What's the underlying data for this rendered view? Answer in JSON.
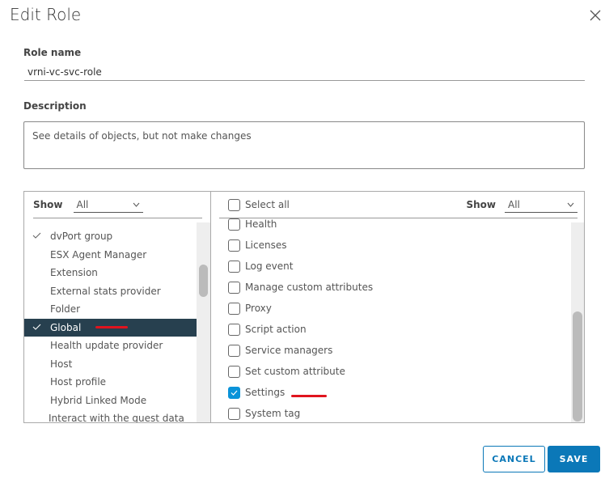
{
  "dialog": {
    "title": "Edit Role",
    "close_icon": "close-icon"
  },
  "role_name": {
    "label": "Role name",
    "value": "vrni-vc-svc-role"
  },
  "description": {
    "label": "Description",
    "value": "See details of objects, but not make changes"
  },
  "left_panel": {
    "show_label": "Show",
    "show_value": "All",
    "items": [
      {
        "label": "dvPort group",
        "checked": true
      },
      {
        "label": "ESX Agent Manager",
        "checked": false
      },
      {
        "label": "Extension",
        "checked": false
      },
      {
        "label": "External stats provider",
        "checked": false
      },
      {
        "label": "Folder",
        "checked": false
      },
      {
        "label": "Global",
        "checked": true,
        "selected": true
      },
      {
        "label": "Health update provider",
        "checked": false
      },
      {
        "label": "Host",
        "checked": false
      },
      {
        "label": "Host profile",
        "checked": false
      },
      {
        "label": "Hybrid Linked Mode",
        "checked": false
      },
      {
        "label": "Interact with the guest data",
        "checked": false
      }
    ]
  },
  "right_panel": {
    "select_all_label": "Select all",
    "show_label": "Show",
    "show_value": "All",
    "items": [
      {
        "label": "Health",
        "checked": false
      },
      {
        "label": "Licenses",
        "checked": false
      },
      {
        "label": "Log event",
        "checked": false
      },
      {
        "label": "Manage custom attributes",
        "checked": false
      },
      {
        "label": "Proxy",
        "checked": false
      },
      {
        "label": "Script action",
        "checked": false
      },
      {
        "label": "Service managers",
        "checked": false
      },
      {
        "label": "Set custom attribute",
        "checked": false
      },
      {
        "label": "Settings",
        "checked": true
      },
      {
        "label": "System tag",
        "checked": false
      }
    ]
  },
  "footer": {
    "cancel_label": "CANCEL",
    "save_label": "SAVE"
  },
  "colors": {
    "primary": "#0b78b8",
    "selected_row": "#27404f",
    "checkbox_on": "#0a93d9",
    "annotation": "#e0141e"
  }
}
